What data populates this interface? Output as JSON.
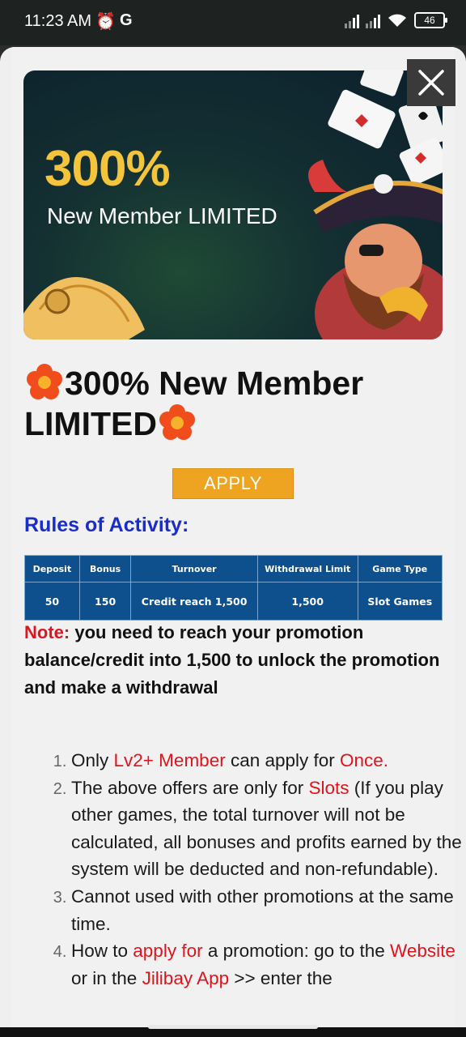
{
  "status_bar": {
    "time": "11:23 AM",
    "carrier_icon": "G",
    "battery": "46",
    "icons": [
      "alarm-icon",
      "signal-icon",
      "wifi-icon",
      "battery-icon"
    ]
  },
  "banner": {
    "percent": "300%",
    "subtitle": "New Member LIMITED"
  },
  "promo": {
    "title": "300% New Member LIMITED",
    "apply_label": "APPLY",
    "rules_heading": "Rules of Activity:"
  },
  "table": {
    "headers": [
      "Deposit",
      "Bonus",
      "Turnover",
      "Withdrawal Limit",
      "Game Type"
    ],
    "row": [
      "50",
      "150",
      "Credit reach 1,500",
      "1,500",
      "Slot Games"
    ]
  },
  "note": {
    "label": "Note:",
    "text": "you need to reach your promotion balance/credit into 1,500 to unlock the promotion and make a withdrawal"
  },
  "terms": [
    {
      "parts": [
        "Only ",
        "Lv2+ Member",
        " can apply for ",
        "Once."
      ]
    },
    {
      "parts": [
        "The above offers are only for ",
        "Slots",
        " (If you play other games, the total turnover will not be calculated, all bonuses and profits earned by the system will be deducted and non-refundable)."
      ]
    },
    {
      "parts": [
        "Cannot used with other promotions at the same time."
      ]
    },
    {
      "parts": [
        "How to ",
        "apply for",
        " a promotion: go to the ",
        "Website",
        " or in the ",
        "Jilibay App",
        " >> enter the"
      ]
    }
  ],
  "colors": {
    "accent_orange": "#eea421",
    "heading_blue": "#1a2dc8",
    "highlight_red": "#e0141c",
    "table_blue": "#0e4f8e"
  }
}
